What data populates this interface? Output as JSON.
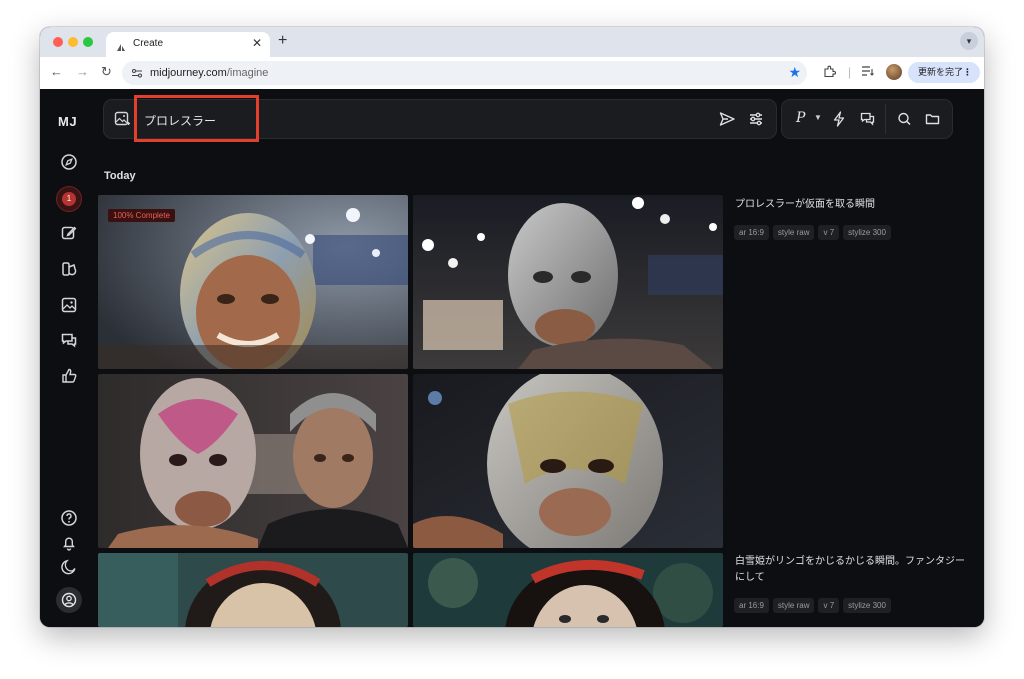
{
  "browser": {
    "tab_title": "Create",
    "new_tab": "+",
    "url_host": "midjourney.com",
    "url_path": "/imagine",
    "update_label": "更新を完了",
    "update_menu": "⋮"
  },
  "app": {
    "logo": "MJ",
    "notification_count": "1",
    "prompt_text": "プロレスラー",
    "mode_label": "P",
    "section_title": "Today"
  },
  "jobs": [
    {
      "prompt": "プロレスラーが仮面を取る瞬間",
      "progress": "100% Complete",
      "params": [
        "ar 16:9",
        "style raw",
        "v 7",
        "stylize 300"
      ]
    },
    {
      "prompt": "白雪姫がリンゴをかじるかじる瞬間。ファンタジーにして",
      "params": [
        "ar 16:9",
        "style raw",
        "v 7",
        "stylize 300"
      ]
    }
  ],
  "colors": {
    "app_bg": "#0d0e11",
    "panel": "#1b1c20",
    "highlight": "#e2402c",
    "badge_red": "#b6342f",
    "chrome_tab_strip": "#dfe3ec",
    "star_blue": "#1a73e8"
  }
}
